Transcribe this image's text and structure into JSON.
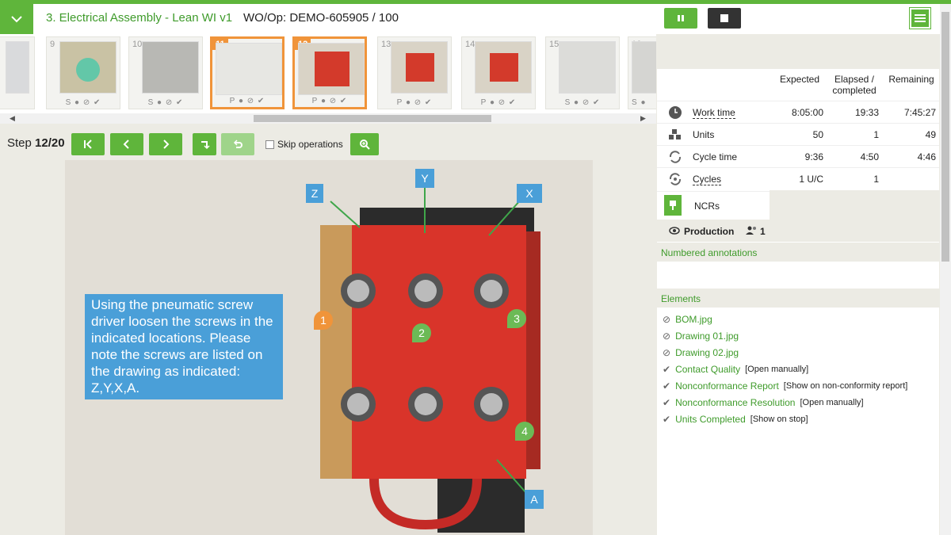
{
  "header": {
    "wi_title": "3. Electrical Assembly - Lean WI v1",
    "wo_title": "WO/Op: DEMO-605905 / 100"
  },
  "thumbnails": [
    {
      "num": "9",
      "status": "S",
      "active": false
    },
    {
      "num": "10",
      "status": "S",
      "active": false
    },
    {
      "num": "11",
      "status": "P",
      "active": true
    },
    {
      "num": "12",
      "status": "P",
      "active": true
    },
    {
      "num": "13",
      "status": "P",
      "active": false
    },
    {
      "num": "14",
      "status": "P",
      "active": false
    },
    {
      "num": "15",
      "status": "S",
      "active": false
    },
    {
      "num": "16",
      "status": "S",
      "active": false
    }
  ],
  "step": {
    "label": "Step",
    "value": "12/20"
  },
  "skip_label": "Skip operations",
  "instruction": "Using the pneumatic screw driver loosen the screws in the indicated locations. Please note the screws are listed on the drawing as indicated: Z,Y,X,A.",
  "annotations": {
    "letters": [
      "Z",
      "Y",
      "X",
      "A"
    ],
    "numbers": [
      "1",
      "2",
      "3",
      "4"
    ]
  },
  "stats": {
    "headers": {
      "expected": "Expected",
      "elapsed": "Elapsed / completed",
      "remaining": "Remaining"
    },
    "rows": [
      {
        "name": "Work time",
        "expected": "8:05:00",
        "elapsed": "19:33",
        "remaining": "7:45:27"
      },
      {
        "name": "Units",
        "expected": "50",
        "elapsed": "1",
        "remaining": "49"
      },
      {
        "name": "Cycle time",
        "expected": "9:36",
        "elapsed": "4:50",
        "remaining": "4:46"
      },
      {
        "name": "Cycles",
        "expected": "1 U/C",
        "elapsed": "1",
        "remaining": ""
      },
      {
        "name": "NCRs",
        "expected": "",
        "elapsed": "",
        "remaining": ""
      }
    ]
  },
  "production": {
    "label": "Production",
    "users": "1"
  },
  "sections": {
    "numbered": "Numbered annotations",
    "elements": "Elements"
  },
  "elements": [
    {
      "name": "BOM.jpg",
      "extra": "",
      "icon": "link-icon"
    },
    {
      "name": "Drawing 01.jpg",
      "extra": "",
      "icon": "link-icon"
    },
    {
      "name": "Drawing 02.jpg",
      "extra": "",
      "icon": "link-icon"
    },
    {
      "name": "Contact Quality",
      "extra": "[Open manually]",
      "icon": "check-icon"
    },
    {
      "name": "Nonconformance Report",
      "extra": "[Show on non-conformity report]",
      "icon": "check-icon"
    },
    {
      "name": "Nonconformance Resolution",
      "extra": "[Open manually]",
      "icon": "check-icon"
    },
    {
      "name": "Units Completed",
      "extra": "[Show on stop]",
      "icon": "check-icon"
    }
  ],
  "colors": {
    "accent": "#5fb53b",
    "active_thumb": "#f0943a",
    "annotation_blue": "#4a9fd8",
    "dark_button": "#333333"
  }
}
